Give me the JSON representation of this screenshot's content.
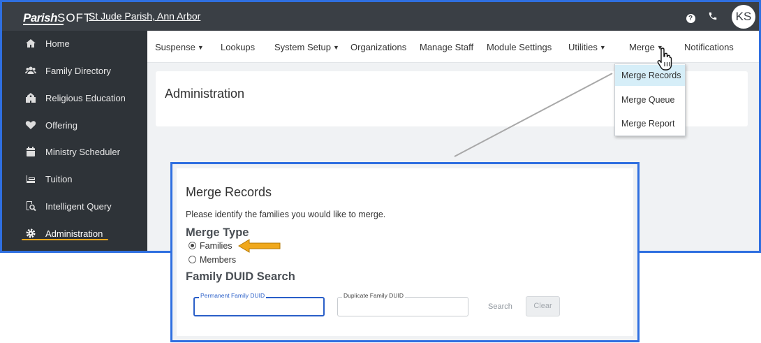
{
  "topbar": {
    "logo": {
      "part1": "Parish",
      "part2": "SOFT"
    },
    "parish_name": "St Jude Parish, Ann Arbor",
    "avatar_initials": "KS"
  },
  "sidebar": {
    "items": [
      {
        "label": "Home",
        "icon": "home-icon"
      },
      {
        "label": "Family Directory",
        "icon": "users-icon"
      },
      {
        "label": "Religious Education",
        "icon": "school-icon"
      },
      {
        "label": "Offering",
        "icon": "heart-icon"
      },
      {
        "label": "Ministry Scheduler",
        "icon": "calendar-icon"
      },
      {
        "label": "Tuition",
        "icon": "tuition-icon"
      },
      {
        "label": "Intelligent Query",
        "icon": "query-icon"
      },
      {
        "label": "Administration",
        "icon": "gear-icon"
      }
    ],
    "active": "Administration",
    "active_color": "#f0a81c"
  },
  "menubar": {
    "items": [
      {
        "label": "Suspense",
        "dropdown": true
      },
      {
        "label": "Lookups",
        "dropdown": false
      },
      {
        "label": "System Setup",
        "dropdown": true
      },
      {
        "label": "Organizations",
        "dropdown": false
      },
      {
        "label": "Manage Staff",
        "dropdown": false
      },
      {
        "label": "Module Settings",
        "dropdown": false
      },
      {
        "label": "Utilities",
        "dropdown": true
      },
      {
        "label": "Merge",
        "dropdown": true
      },
      {
        "label": "Notifications",
        "dropdown": false
      }
    ]
  },
  "main": {
    "title": "Administration"
  },
  "merge_dropdown": {
    "items": [
      "Merge Records",
      "Merge Queue",
      "Merge Report"
    ],
    "highlighted": "Merge Records"
  },
  "merge_records": {
    "title": "Merge Records",
    "description": "Please identify the families you would like to merge.",
    "merge_type_heading": "Merge Type",
    "merge_type_options": [
      "Families",
      "Members"
    ],
    "selected_type": "Families",
    "search_heading": "Family DUID Search",
    "permanent_label": "Permanent Family DUID",
    "permanent_value": "",
    "duplicate_label": "Duplicate Family DUID",
    "duplicate_value": "",
    "search_label": "Search",
    "clear_label": "Clear"
  },
  "colors": {
    "frame_border": "#2f6fe0",
    "topbar_bg": "#3a3f45",
    "sidebar_bg": "#2e3338",
    "dropdown_highlight": "#d6eef8",
    "arrow": "#f0a81c"
  }
}
